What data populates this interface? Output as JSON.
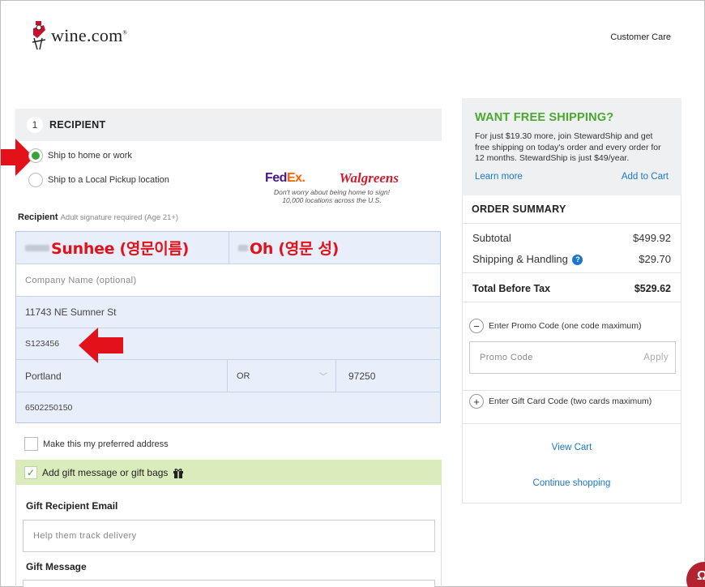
{
  "header": {
    "logo_text": "wine.com",
    "logo_mark": "®",
    "customer_care": "Customer Care"
  },
  "recipient": {
    "step_number": "1",
    "title": "RECIPIENT",
    "option_home": "Ship to home or work",
    "option_pickup": "Ship to a Local Pickup location",
    "selected_option": "home",
    "carriers": {
      "fedex_fed": "Fed",
      "fedex_ex": "Ex.",
      "walgreens": "Walgreens",
      "note_line1": "Don't worry about being home to sign!",
      "note_line2": "10,000 locations across the U.S."
    },
    "label": "Recipient",
    "label_note": "Adult signature required (Age 21+)",
    "first_name": "Sunhee  (영문이름)",
    "last_name": "Oh (영문 성)",
    "company_placeholder": "Company Name (optional)",
    "address1": "11743 NE Sumner St",
    "address2": "S123456",
    "city": "Portland",
    "state": "OR",
    "zip": "97250",
    "phone": "6502250150",
    "preferred_label": "Make this my preferred address"
  },
  "gift": {
    "bar_label": "Add gift message or gift bags",
    "bar_checked": true,
    "email_label": "Gift Recipient Email",
    "email_placeholder": "Help them track delivery",
    "message_label": "Gift Message"
  },
  "free_shipping": {
    "title": "WANT FREE SHIPPING?",
    "text": "For just $19.30 more, join StewardShip and get free shipping on today's order and every order for 12 months. StewardShip is just $49/year.",
    "learn_more": "Learn more",
    "add_to_cart": "Add to Cart"
  },
  "order_summary": {
    "title": "ORDER SUMMARY",
    "subtotal_label": "Subtotal",
    "subtotal_value": "$499.92",
    "shipping_label": "Shipping & Handling",
    "shipping_value": "$29.70",
    "total_label": "Total Before Tax",
    "total_value": "$529.62",
    "promo_toggle": "Enter Promo Code (one code maximum)",
    "promo_placeholder": "Promo Code",
    "promo_apply": "Apply",
    "giftcard_toggle": "Enter Gift Card Code (two cards maximum)",
    "view_cart": "View Cart",
    "continue_shopping": "Continue shopping"
  },
  "colors": {
    "accent_green": "#3aa336",
    "link_blue": "#1a77c9",
    "annotation_red": "#e3121a",
    "form_fill": "#e8effb",
    "gift_bar": "#dbecbc"
  }
}
